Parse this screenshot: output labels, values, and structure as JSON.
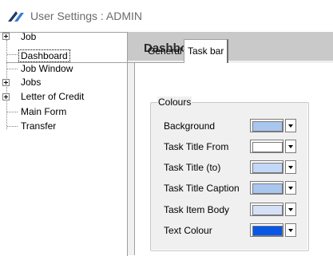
{
  "window": {
    "title": "User Settings : ADMIN"
  },
  "tree": {
    "items": [
      {
        "label": "Job",
        "expandable": true
      },
      {
        "label": "Dashboard",
        "expandable": false,
        "selected": true
      },
      {
        "label": "Job Window",
        "expandable": false
      },
      {
        "label": "Jobs",
        "expandable": true
      },
      {
        "label": "Letter of Credit",
        "expandable": true
      },
      {
        "label": "Main Form",
        "expandable": false
      },
      {
        "label": "Transfer",
        "expandable": false
      }
    ]
  },
  "panel": {
    "title": "Dashboard",
    "tabs": [
      {
        "label": "General",
        "active": false
      },
      {
        "label": "Task bar",
        "active": true
      }
    ],
    "group": {
      "label": "Colours",
      "rows": [
        {
          "label": "Background",
          "color": "#a9c6ef"
        },
        {
          "label": "Task Title From",
          "color": "#ffffff"
        },
        {
          "label": "Task Title (to)",
          "color": "#c3d7f7"
        },
        {
          "label": "Task Title Caption",
          "color": "#a9c6ef"
        },
        {
          "label": "Task Item Body",
          "color": "#d6e1f7"
        },
        {
          "label": "Text Colour",
          "color": "#0a56e6"
        }
      ]
    }
  }
}
